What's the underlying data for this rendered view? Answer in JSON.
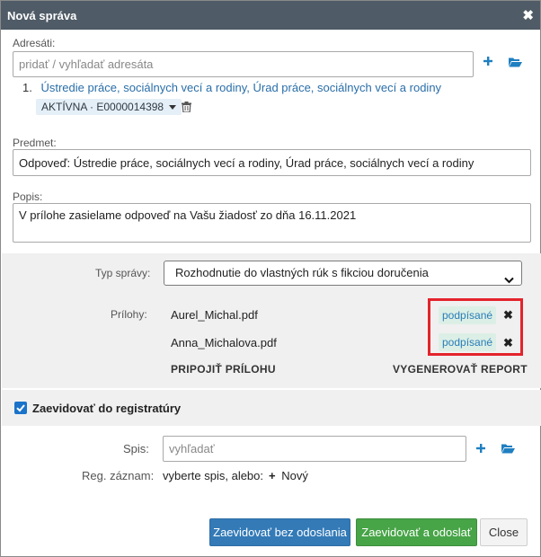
{
  "dialog": {
    "title": "Nová správa",
    "close_icon": "close-icon"
  },
  "recipients": {
    "label": "Adresáti:",
    "placeholder": "pridať / vyhľadať adresáta",
    "items": [
      {
        "number": "1.",
        "name": "Ústredie práce, sociálnych vecí a rodiny, Úrad práce, sociálnych vecí a rodiny",
        "badge": "AKTÍVNA · E0000014398"
      }
    ]
  },
  "subject": {
    "label": "Predmet:",
    "value": "Odpoveď: Ústredie práce, sociálnych vecí a rodiny, Úrad práce, sociálnych vecí a rodiny"
  },
  "description": {
    "label": "Popis:",
    "value": "V prílohe zasielame odpoveď na Vašu žiadosť zo dňa 16.11.2021"
  },
  "message_type": {
    "label": "Typ správy:",
    "selected": "Rozhodnutie do vlastných rúk s fikciou doručenia"
  },
  "attachments": {
    "label": "Prílohy:",
    "files": [
      {
        "name": "Aurel_Michal.pdf",
        "status": "podpísané"
      },
      {
        "name": "Anna_Michalova.pdf",
        "status": "podpísané"
      }
    ],
    "attach_label": "PRIPOJIŤ PRÍLOHU",
    "report_label": "VYGENEROVAŤ REPORT"
  },
  "registry": {
    "checkbox_label": "Zaevidovať do registratúry",
    "checked": true
  },
  "file_ref": {
    "label": "Spis:",
    "placeholder": "vyhľadať"
  },
  "reg_record": {
    "label": "Reg. záznam:",
    "text": "vyberte spis, alebo:",
    "new_label": "Nový"
  },
  "buttons": {
    "register_only": "Zaevidovať bez odoslania",
    "register_send": "Zaevidovať a odoslať",
    "close": "Close"
  },
  "colors": {
    "titlebar": "#4f5b66",
    "accent": "#1f7fc1",
    "primary": "#337ab7",
    "success": "#47a447",
    "highlight": "#e4232c"
  }
}
